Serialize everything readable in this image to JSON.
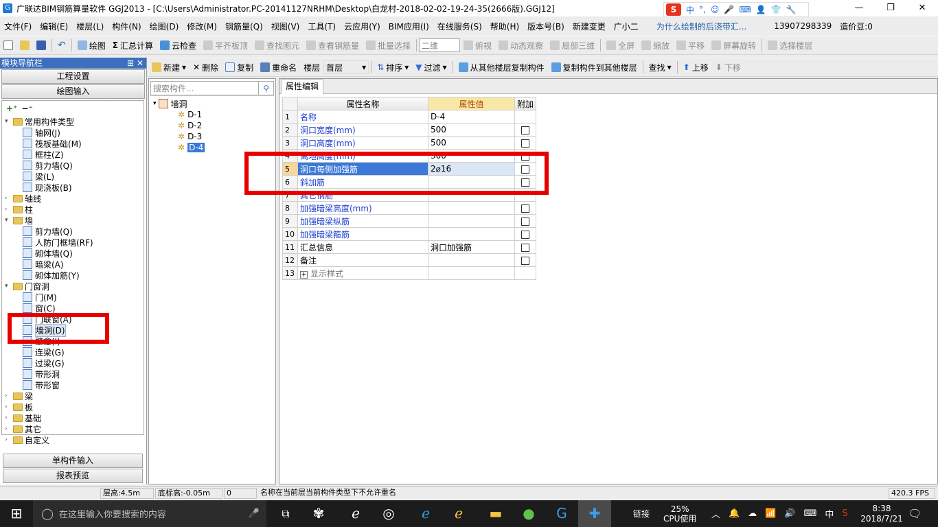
{
  "window": {
    "title": "广联达BIM钢筋算量软件 GGJ2013 - [C:\\Users\\Administrator.PC-20141127NRHM\\Desktop\\白龙村-2018-02-02-19-24-35(2666版).GGJ12]",
    "controls": {
      "minimize": "—",
      "maximize": "❐",
      "close": "✕"
    }
  },
  "ime_bar": [
    "中",
    "°,",
    "☺",
    "🎤",
    "⌨",
    "👤",
    "👕",
    "🔧"
  ],
  "menu": [
    "文件(F)",
    "编辑(E)",
    "楼层(L)",
    "构件(N)",
    "绘图(D)",
    "修改(M)",
    "钢筋量(Q)",
    "视图(V)",
    "工具(T)",
    "云应用(Y)",
    "BIM应用(I)",
    "在线服务(S)",
    "帮助(H)",
    "版本号(B)",
    "新建变更",
    "广小二"
  ],
  "menu_tip": "为什么绘制的后浇带汇...",
  "account": {
    "phone": "13907298339",
    "beans": "造价豆:0"
  },
  "toolbar1": {
    "draw": "绘图",
    "summary": "汇总计算",
    "cloud_check": "云检查",
    "flat_top": "平齐板顶",
    "find_elem": "查找图元",
    "view_rebar": "查看钢筋量",
    "batch_select": "批量选择",
    "view_mode": "二维",
    "top_view": "俯视",
    "dynamic": "动态观察",
    "local3d": "局部三维",
    "fullscreen": "全屏",
    "zoom": "缩放",
    "pan": "平移",
    "rotate": "屏幕旋转",
    "select_floor": "选择楼层"
  },
  "toolbar2": {
    "new": "新建",
    "delete": "删除",
    "copy": "复制",
    "rename": "重命名",
    "floor_label": "楼层",
    "floor_value": "首层",
    "sort": "排序",
    "filter": "过滤",
    "copy_from": "从其他楼层复制构件",
    "copy_to": "复制构件到其他楼层",
    "find": "查找",
    "up": "上移",
    "down": "下移"
  },
  "nav": {
    "title": "模块导航栏",
    "pin": "⊞",
    "close": "✕",
    "btn_project": "工程设置",
    "btn_draw": "绘图输入",
    "btn_single": "单构件输入",
    "btn_report": "报表预览"
  },
  "tree": [
    "常用构件类型",
    "轴网(J)",
    "筏板基础(M)",
    "框柱(Z)",
    "剪力墙(Q)",
    "梁(L)",
    "现浇板(B)",
    "轴线",
    "柱",
    "墙",
    "剪力墙(Q)",
    "人防门框墙(RF)",
    "砌体墙(Q)",
    "暗梁(A)",
    "砌体加筋(Y)",
    "门窗洞",
    "门(M)",
    "窗(C)",
    "门联窗(A)",
    "墙洞(D)",
    "壁龛(I)",
    "连梁(G)",
    "过梁(G)",
    "带形洞",
    "带形窗",
    "梁",
    "板",
    "基础",
    "其它",
    "自定义"
  ],
  "search": {
    "placeholder": "搜索构件..."
  },
  "component_tree": {
    "root": "墙洞",
    "items": [
      "D-1",
      "D-2",
      "D-3",
      "D-4"
    ]
  },
  "property": {
    "tab": "属性编辑",
    "headers": {
      "name": "属性名称",
      "value": "属性值",
      "extra": "附加"
    },
    "rows": [
      {
        "n": "1",
        "name": "名称",
        "value": "D-4",
        "cb": false
      },
      {
        "n": "2",
        "name": "洞口宽度(mm)",
        "value": "500",
        "cb": true
      },
      {
        "n": "3",
        "name": "洞口高度(mm)",
        "value": "500",
        "cb": true
      },
      {
        "n": "4",
        "name": "离地高度(mm)",
        "value": "300",
        "cb": true
      },
      {
        "n": "5",
        "name": "洞口每侧加强筋",
        "value": "2⌀16",
        "cb": true
      },
      {
        "n": "6",
        "name": "斜加筋",
        "value": "",
        "cb": true
      },
      {
        "n": "7",
        "name": "其它钢筋",
        "value": "",
        "cb": false
      },
      {
        "n": "8",
        "name": "加强暗梁高度(mm)",
        "value": "",
        "cb": true
      },
      {
        "n": "9",
        "name": "加强暗梁纵筋",
        "value": "",
        "cb": true
      },
      {
        "n": "10",
        "name": "加强暗梁箍筋",
        "value": "",
        "cb": true
      },
      {
        "n": "11",
        "name": "汇总信息",
        "value": "洞口加强筋",
        "cb": true
      },
      {
        "n": "12",
        "name": "备注",
        "value": "",
        "cb": true
      },
      {
        "n": "13",
        "name": "显示样式",
        "value": "",
        "cb": false
      }
    ]
  },
  "status": {
    "floor_height": "层高:4.5m",
    "base_height": "底标高:-0.05m",
    "count": "0",
    "message": "名称在当前层当前构件类型下不允许重名",
    "fps": "420.3 FPS"
  },
  "taskbar": {
    "search_placeholder": "在这里输入你要搜索的内容",
    "link": "链接",
    "cpu_pct": "25%",
    "cpu_label": "CPU使用",
    "lang": "中",
    "time": "8:38",
    "date": "2018/7/21"
  }
}
